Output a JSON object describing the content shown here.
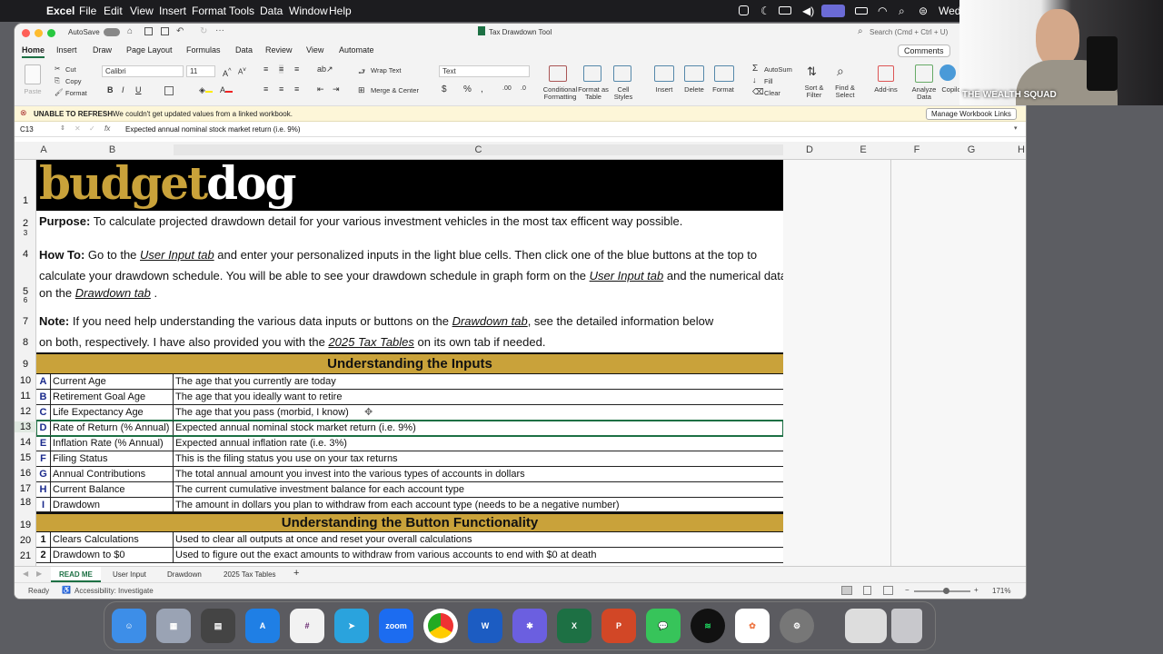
{
  "menubar": {
    "app": "Excel",
    "items": [
      "File",
      "Edit",
      "View",
      "Insert",
      "Format",
      "Tools",
      "Data",
      "Window",
      "Help"
    ],
    "clock": "Wed C"
  },
  "window": {
    "autosave": "AutoSave",
    "title": "Tax Drawdown Tool",
    "search_placeholder": "Search (Cmd + Ctrl + U)"
  },
  "tabs": [
    "Home",
    "Insert",
    "Draw",
    "Page Layout",
    "Formulas",
    "Data",
    "Review",
    "View",
    "Automate"
  ],
  "comments": "Comments",
  "ribbon": {
    "paste": "Paste",
    "cut": "Cut",
    "copy": "Copy",
    "format": "Format",
    "font": "Calibri",
    "size": "11",
    "wrap": "Wrap Text",
    "merge": "Merge & Center",
    "numfmt": "Text",
    "cond": "Conditional Formatting",
    "fmt_table": "Format as Table",
    "cell_styles": "Cell Styles",
    "insert": "Insert",
    "delete": "Delete",
    "format2": "Format",
    "autosum": "AutoSum",
    "fill": "Fill",
    "clear": "Clear",
    "sort": "Sort & Filter",
    "find": "Find & Select",
    "addins": "Add-ins",
    "analyze": "Analyze Data",
    "copilot": "Copilo"
  },
  "message": {
    "title": "UNABLE TO REFRESH",
    "text": "We couldn't get updated values from a linked workbook.",
    "button": "Manage Workbook Links"
  },
  "formula": {
    "cell": "C13",
    "fx": "fx",
    "content": "Expected annual nominal stock market return (i.e. 9%)"
  },
  "columns": [
    "A",
    "B",
    "C",
    "D",
    "E",
    "F",
    "G",
    "H"
  ],
  "rows": [
    "1",
    "2",
    "3",
    "4",
    "5",
    "6",
    "7",
    "8",
    "9",
    "10",
    "11",
    "12",
    "13",
    "14",
    "15",
    "16",
    "17",
    "18",
    "19",
    "20",
    "21"
  ],
  "logo": {
    "part1": "budget",
    "part2": "dog"
  },
  "purpose": {
    "label": "Purpose:",
    "text": " To calculate projected drawdown detail for your various investment vehicles in the most tax efficent way possible."
  },
  "howto": {
    "label": "How To:",
    "t1": " Go to the ",
    "l1": "User Input tab",
    "t2": "  and enter your personalized inputs in the light blue cells. Then click one of the blue buttons at the top to",
    "t3": "calculate your drawdown schedule. You will be able to see your drawdown schedule in graph form on the ",
    "l2": "User Input tab",
    "t4": "  and the numerical data",
    "t5": "on the ",
    "l3": "Drawdown tab",
    "t6": " ."
  },
  "note": {
    "label": "Note:",
    "t1": " If you need help understanding the various data inputs or buttons on the ",
    "l1": "Drawdown tab",
    "t2": ", see the detailed information below",
    "t3": "on both, respectively. I have also provided you with the ",
    "l2": "2025 Tax Tables",
    "t4": " on its own tab if needed."
  },
  "inputs_header": "Understanding the Inputs",
  "inputs": [
    {
      "key": "A",
      "name": "Current Age",
      "desc": "The age that you currently are today"
    },
    {
      "key": "B",
      "name": "Retirement Goal Age",
      "desc": "The age that you ideally want to retire"
    },
    {
      "key": "C",
      "name": "Life Expectancy Age",
      "desc": "The age that you pass (morbid, I know)"
    },
    {
      "key": "D",
      "name": "Rate of Return (% Annual)",
      "desc": "Expected annual nominal stock market return (i.e. 9%)"
    },
    {
      "key": "E",
      "name": "Inflation Rate (% Annual)",
      "desc": "Expected annual inflation rate (i.e. 3%)"
    },
    {
      "key": "F",
      "name": "Filing Status",
      "desc": "This is the filing status you use on your tax returns"
    },
    {
      "key": "G",
      "name": "Annual Contributions",
      "desc": "The total annual amount you invest into the various types of accounts in dollars"
    },
    {
      "key": "H",
      "name": "Current Balance",
      "desc": "The current cumulative investment balance for each account type"
    },
    {
      "key": "I",
      "name": "Drawdown",
      "desc": "The amount in dollars you plan to withdraw from each account type (needs to be a negative number)"
    }
  ],
  "buttons_header": "Understanding the Button Functionality",
  "buttons": [
    {
      "key": "1",
      "name": "Clears Calculations",
      "desc": "Used to clear all outputs at once and reset your overall calculations"
    },
    {
      "key": "2",
      "name": "Drawdown to $0",
      "desc": "Used to figure out the exact amounts to withdraw from various accounts to end with $0 at death"
    }
  ],
  "sheettabs": [
    "READ ME",
    "User Input",
    "Drawdown",
    "2025 Tax Tables"
  ],
  "status": {
    "ready": "Ready",
    "accessibility": "Accessibility: Investigate",
    "zoom": "171%"
  },
  "video": {
    "caption": "THE WEALTH SQUAD"
  },
  "dock": [
    "Finder",
    "Launchpad",
    "Calculator",
    "App Store",
    "Slack",
    "Telegram",
    "zoom",
    "Chrome",
    "Word",
    "Settings",
    "Excel",
    "PowerPoint",
    "Messages",
    "Spotify",
    "Photos",
    "System",
    "Preview",
    "Trash"
  ]
}
